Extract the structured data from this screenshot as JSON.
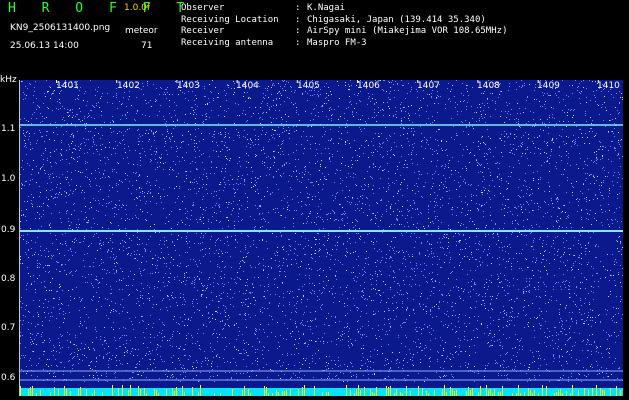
{
  "header": {
    "app_title": "H R O F F T",
    "version": "1.0.0f",
    "filename": "KN9_2506131400.png",
    "datetime": "25.06.13 14:00",
    "meteor_label": "meteor",
    "meteor_count": "71",
    "info": [
      {
        "label": "Observer",
        "value": "K.Nagai"
      },
      {
        "label": "Receiving Location",
        "value": "Chigasaki, Japan (139.414 35.340)"
      },
      {
        "label": "Receiver",
        "value": "AirSpy mini (Miakejima VOR 108.65MHz)"
      },
      {
        "label": "Receiving antenna",
        "value": "Maspro FM-3"
      }
    ]
  },
  "plot": {
    "y_unit": "kHz",
    "y_ticks": [
      "1.1",
      "1.0",
      "0.9",
      "0.8",
      "0.7",
      "0.6"
    ],
    "x_ticks": [
      "1401",
      "1402",
      "1403",
      "1404",
      "1405",
      "1406",
      "1407",
      "1408",
      "1409",
      "1410"
    ],
    "colors": {
      "background": "#0a1a8c",
      "carrier_line": "#7fe9ff",
      "bottom_band": "#00e5ff",
      "bottom_spikes": "#ffff00"
    }
  }
}
